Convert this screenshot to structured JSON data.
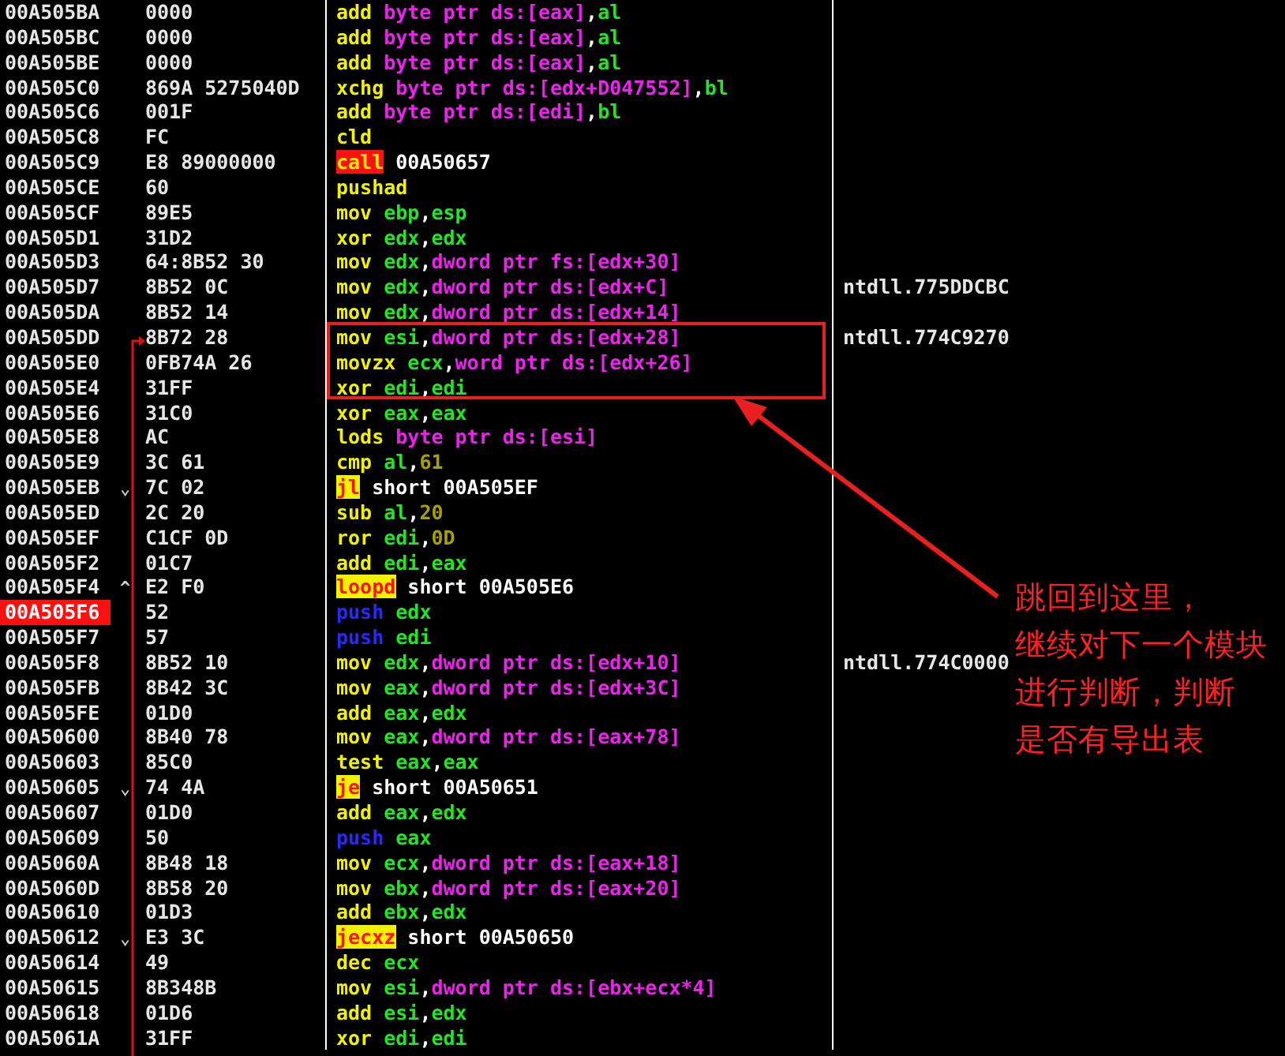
{
  "rows": [
    {
      "address": "00A505BA",
      "hex": "0000",
      "selected": false,
      "tokens": [
        {
          "text": "add",
          "kind": "op"
        },
        {
          "text": "byte ptr ds:[eax]",
          "kind": "mem"
        },
        {
          "text": ",",
          "kind": "sep"
        },
        {
          "text": "al",
          "kind": "reg"
        }
      ]
    },
    {
      "address": "00A505BC",
      "hex": "0000",
      "selected": false,
      "tokens": [
        {
          "text": "add",
          "kind": "op"
        },
        {
          "text": "byte ptr ds:[eax]",
          "kind": "mem"
        },
        {
          "text": ",",
          "kind": "sep"
        },
        {
          "text": "al",
          "kind": "reg"
        }
      ]
    },
    {
      "address": "00A505BE",
      "hex": "0000",
      "selected": false,
      "tokens": [
        {
          "text": "add",
          "kind": "op"
        },
        {
          "text": "byte ptr ds:[eax]",
          "kind": "mem"
        },
        {
          "text": ",",
          "kind": "sep"
        },
        {
          "text": "al",
          "kind": "reg"
        }
      ]
    },
    {
      "address": "00A505C0",
      "hex": "869A 5275040D",
      "selected": false,
      "tokens": [
        {
          "text": "xchg",
          "kind": "op"
        },
        {
          "text": "byte ptr ds:[edx+D047552]",
          "kind": "mem"
        },
        {
          "text": ",",
          "kind": "sep"
        },
        {
          "text": "bl",
          "kind": "reg"
        }
      ]
    },
    {
      "address": "00A505C6",
      "hex": "001F",
      "selected": false,
      "tokens": [
        {
          "text": "add",
          "kind": "op"
        },
        {
          "text": "byte ptr ds:[edi]",
          "kind": "mem"
        },
        {
          "text": ",",
          "kind": "sep"
        },
        {
          "text": "bl",
          "kind": "reg"
        }
      ]
    },
    {
      "address": "00A505C8",
      "hex": "FC",
      "selected": false,
      "tokens": [
        {
          "text": "cld",
          "kind": "op"
        }
      ]
    },
    {
      "address": "00A505C9",
      "hex": "E8 89000000",
      "selected": false,
      "tokens": [
        {
          "text": "call",
          "kind": "call"
        },
        {
          "text": "00A50657",
          "kind": "addr"
        }
      ]
    },
    {
      "address": "00A505CE",
      "hex": "60",
      "selected": false,
      "tokens": [
        {
          "text": "pushad",
          "kind": "op"
        }
      ]
    },
    {
      "address": "00A505CF",
      "hex": "89E5",
      "selected": false,
      "tokens": [
        {
          "text": "mov",
          "kind": "op"
        },
        {
          "text": "ebp",
          "kind": "reg"
        },
        {
          "text": ",",
          "kind": "sep"
        },
        {
          "text": "esp",
          "kind": "reg"
        }
      ]
    },
    {
      "address": "00A505D1",
      "hex": "31D2",
      "selected": false,
      "tokens": [
        {
          "text": "xor",
          "kind": "op"
        },
        {
          "text": "edx",
          "kind": "reg"
        },
        {
          "text": ",",
          "kind": "sep"
        },
        {
          "text": "edx",
          "kind": "reg"
        }
      ]
    },
    {
      "address": "00A505D3",
      "hex": "64:8B52 30",
      "selected": false,
      "tokens": [
        {
          "text": "mov",
          "kind": "op"
        },
        {
          "text": "edx",
          "kind": "reg"
        },
        {
          "text": ",",
          "kind": "sep"
        },
        {
          "text": "dword ptr fs:[edx+30]",
          "kind": "mem"
        }
      ]
    },
    {
      "address": "00A505D7",
      "hex": "8B52 0C",
      "selected": false,
      "comment": "ntdll.775DDCBC",
      "tokens": [
        {
          "text": "mov",
          "kind": "op"
        },
        {
          "text": "edx",
          "kind": "reg"
        },
        {
          "text": ",",
          "kind": "sep"
        },
        {
          "text": "dword ptr ds:[edx+C]",
          "kind": "mem"
        }
      ]
    },
    {
      "address": "00A505DA",
      "hex": "8B52 14",
      "selected": false,
      "tokens": [
        {
          "text": "mov",
          "kind": "op"
        },
        {
          "text": "edx",
          "kind": "reg"
        },
        {
          "text": ",",
          "kind": "sep"
        },
        {
          "text": "dword ptr ds:[edx+14]",
          "kind": "mem"
        }
      ]
    },
    {
      "address": "00A505DD",
      "hex": "8B72 28",
      "selected": false,
      "comment": "ntdll.774C9270",
      "tokens": [
        {
          "text": "mov",
          "kind": "op"
        },
        {
          "text": "esi",
          "kind": "reg"
        },
        {
          "text": ",",
          "kind": "sep"
        },
        {
          "text": "dword ptr ds:[edx+28]",
          "kind": "mem"
        }
      ]
    },
    {
      "address": "00A505E0",
      "hex": "0FB74A 26",
      "selected": false,
      "tokens": [
        {
          "text": "movzx",
          "kind": "op"
        },
        {
          "text": "ecx",
          "kind": "reg"
        },
        {
          "text": ",",
          "kind": "sep"
        },
        {
          "text": "word ptr ds:[edx+26]",
          "kind": "mem"
        }
      ]
    },
    {
      "address": "00A505E4",
      "hex": "31FF",
      "selected": false,
      "tokens": [
        {
          "text": "xor",
          "kind": "op"
        },
        {
          "text": "edi",
          "kind": "reg"
        },
        {
          "text": ",",
          "kind": "sep"
        },
        {
          "text": "edi",
          "kind": "reg"
        }
      ]
    },
    {
      "address": "00A505E6",
      "hex": "31C0",
      "selected": false,
      "tokens": [
        {
          "text": "xor",
          "kind": "op"
        },
        {
          "text": "eax",
          "kind": "reg"
        },
        {
          "text": ",",
          "kind": "sep"
        },
        {
          "text": "eax",
          "kind": "reg"
        }
      ]
    },
    {
      "address": "00A505E8",
      "hex": "AC",
      "selected": false,
      "tokens": [
        {
          "text": "lods",
          "kind": "op"
        },
        {
          "text": "byte ptr ds:[esi]",
          "kind": "mem"
        }
      ]
    },
    {
      "address": "00A505E9",
      "hex": "3C 61",
      "selected": false,
      "tokens": [
        {
          "text": "cmp",
          "kind": "op"
        },
        {
          "text": "al",
          "kind": "reg"
        },
        {
          "text": ",",
          "kind": "sep"
        },
        {
          "text": "61",
          "kind": "imm"
        }
      ]
    },
    {
      "address": "00A505EB",
      "mark": "⌄",
      "hex": "7C 02",
      "selected": false,
      "tokens": [
        {
          "text": "jl",
          "kind": "jump"
        },
        {
          "text": "short 00A505EF",
          "kind": "addr"
        }
      ]
    },
    {
      "address": "00A505ED",
      "hex": "2C 20",
      "selected": false,
      "tokens": [
        {
          "text": "sub",
          "kind": "op"
        },
        {
          "text": "al",
          "kind": "reg"
        },
        {
          "text": ",",
          "kind": "sep"
        },
        {
          "text": "20",
          "kind": "imm"
        }
      ]
    },
    {
      "address": "00A505EF",
      "hex": "C1CF 0D",
      "selected": false,
      "tokens": [
        {
          "text": "ror",
          "kind": "op"
        },
        {
          "text": "edi",
          "kind": "reg"
        },
        {
          "text": ",",
          "kind": "sep"
        },
        {
          "text": "0D",
          "kind": "imm"
        }
      ]
    },
    {
      "address": "00A505F2",
      "hex": "01C7",
      "selected": false,
      "tokens": [
        {
          "text": "add",
          "kind": "op"
        },
        {
          "text": "edi",
          "kind": "reg"
        },
        {
          "text": ",",
          "kind": "sep"
        },
        {
          "text": "eax",
          "kind": "reg"
        }
      ]
    },
    {
      "address": "00A505F4",
      "mark": "^",
      "hex": "E2 F0",
      "selected": false,
      "tokens": [
        {
          "text": "loopd",
          "kind": "jump"
        },
        {
          "text": "short 00A505E6",
          "kind": "addr"
        }
      ]
    },
    {
      "address": "00A505F6",
      "hex": "52",
      "selected": true,
      "tokens": [
        {
          "text": "push",
          "kind": "push"
        },
        {
          "text": "edx",
          "kind": "reg"
        }
      ]
    },
    {
      "address": "00A505F7",
      "hex": "57",
      "selected": false,
      "tokens": [
        {
          "text": "push",
          "kind": "push"
        },
        {
          "text": "edi",
          "kind": "reg"
        }
      ]
    },
    {
      "address": "00A505F8",
      "hex": "8B52 10",
      "selected": false,
      "comment": "ntdll.774C0000",
      "tokens": [
        {
          "text": "mov",
          "kind": "op"
        },
        {
          "text": "edx",
          "kind": "reg"
        },
        {
          "text": ",",
          "kind": "sep"
        },
        {
          "text": "dword ptr ds:[edx+10]",
          "kind": "mem"
        }
      ]
    },
    {
      "address": "00A505FB",
      "hex": "8B42 3C",
      "selected": false,
      "tokens": [
        {
          "text": "mov",
          "kind": "op"
        },
        {
          "text": "eax",
          "kind": "reg"
        },
        {
          "text": ",",
          "kind": "sep"
        },
        {
          "text": "dword ptr ds:[edx+3C]",
          "kind": "mem"
        }
      ]
    },
    {
      "address": "00A505FE",
      "hex": "01D0",
      "selected": false,
      "tokens": [
        {
          "text": "add",
          "kind": "op"
        },
        {
          "text": "eax",
          "kind": "reg"
        },
        {
          "text": ",",
          "kind": "sep"
        },
        {
          "text": "edx",
          "kind": "reg"
        }
      ]
    },
    {
      "address": "00A50600",
      "hex": "8B40 78",
      "selected": false,
      "tokens": [
        {
          "text": "mov",
          "kind": "op"
        },
        {
          "text": "eax",
          "kind": "reg"
        },
        {
          "text": ",",
          "kind": "sep"
        },
        {
          "text": "dword ptr ds:[eax+78]",
          "kind": "mem"
        }
      ]
    },
    {
      "address": "00A50603",
      "hex": "85C0",
      "selected": false,
      "tokens": [
        {
          "text": "test",
          "kind": "op"
        },
        {
          "text": "eax",
          "kind": "reg"
        },
        {
          "text": ",",
          "kind": "sep"
        },
        {
          "text": "eax",
          "kind": "reg"
        }
      ]
    },
    {
      "address": "00A50605",
      "mark": "⌄",
      "hex": "74 4A",
      "selected": false,
      "tokens": [
        {
          "text": "je",
          "kind": "jump"
        },
        {
          "text": "short 00A50651",
          "kind": "addr"
        }
      ]
    },
    {
      "address": "00A50607",
      "hex": "01D0",
      "selected": false,
      "tokens": [
        {
          "text": "add",
          "kind": "op"
        },
        {
          "text": "eax",
          "kind": "reg"
        },
        {
          "text": ",",
          "kind": "sep"
        },
        {
          "text": "edx",
          "kind": "reg"
        }
      ]
    },
    {
      "address": "00A50609",
      "hex": "50",
      "selected": false,
      "tokens": [
        {
          "text": "push",
          "kind": "push"
        },
        {
          "text": "eax",
          "kind": "reg"
        }
      ]
    },
    {
      "address": "00A5060A",
      "hex": "8B48 18",
      "selected": false,
      "tokens": [
        {
          "text": "mov",
          "kind": "op"
        },
        {
          "text": "ecx",
          "kind": "reg"
        },
        {
          "text": ",",
          "kind": "sep"
        },
        {
          "text": "dword ptr ds:[eax+18]",
          "kind": "mem"
        }
      ]
    },
    {
      "address": "00A5060D",
      "hex": "8B58 20",
      "selected": false,
      "tokens": [
        {
          "text": "mov",
          "kind": "op"
        },
        {
          "text": "ebx",
          "kind": "reg"
        },
        {
          "text": ",",
          "kind": "sep"
        },
        {
          "text": "dword ptr ds:[eax+20]",
          "kind": "mem"
        }
      ]
    },
    {
      "address": "00A50610",
      "hex": "01D3",
      "selected": false,
      "tokens": [
        {
          "text": "add",
          "kind": "op"
        },
        {
          "text": "ebx",
          "kind": "reg"
        },
        {
          "text": ",",
          "kind": "sep"
        },
        {
          "text": "edx",
          "kind": "reg"
        }
      ]
    },
    {
      "address": "00A50612",
      "mark": "⌄",
      "hex": "E3 3C",
      "selected": false,
      "tokens": [
        {
          "text": "jecxz",
          "kind": "jump"
        },
        {
          "text": "short 00A50650",
          "kind": "addr"
        }
      ]
    },
    {
      "address": "00A50614",
      "hex": "49",
      "selected": false,
      "tokens": [
        {
          "text": "dec",
          "kind": "op"
        },
        {
          "text": "ecx",
          "kind": "reg"
        }
      ]
    },
    {
      "address": "00A50615",
      "hex": "8B348B",
      "selected": false,
      "tokens": [
        {
          "text": "mov",
          "kind": "op"
        },
        {
          "text": "esi",
          "kind": "reg"
        },
        {
          "text": ",",
          "kind": "sep"
        },
        {
          "text": "dword ptr ds:[ebx+ecx*4]",
          "kind": "mem"
        }
      ]
    },
    {
      "address": "00A50618",
      "hex": "01D6",
      "selected": false,
      "tokens": [
        {
          "text": "add",
          "kind": "op"
        },
        {
          "text": "esi",
          "kind": "reg"
        },
        {
          "text": ",",
          "kind": "sep"
        },
        {
          "text": "edx",
          "kind": "reg"
        }
      ]
    },
    {
      "address": "00A5061A",
      "hex": "31FF",
      "selected": false,
      "tokens": [
        {
          "text": "xor",
          "kind": "op"
        },
        {
          "text": "edi",
          "kind": "reg"
        },
        {
          "text": ",",
          "kind": "sep"
        },
        {
          "text": "edi",
          "kind": "reg"
        }
      ]
    }
  ],
  "annotation": {
    "lines": [
      "跳回到这里，",
      "继续对下一个模块",
      "进行判断，判断",
      "是否有导出表"
    ]
  }
}
